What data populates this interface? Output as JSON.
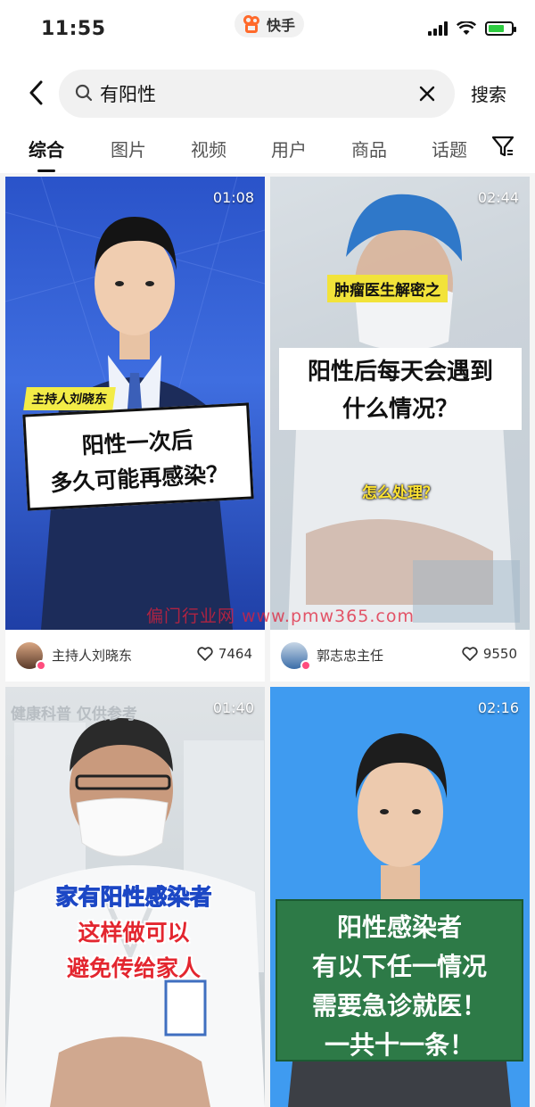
{
  "status": {
    "time": "11:55",
    "app_name": "快手"
  },
  "search": {
    "query": "有阳性",
    "button": "搜索"
  },
  "tabs": [
    "综合",
    "图片",
    "视频",
    "用户",
    "商品",
    "话题"
  ],
  "active_tab": "综合",
  "watermark": "偏门行业网 www.pmw365.com",
  "cards": [
    {
      "duration": "01:08",
      "tag": "主持人刘晓东",
      "caption_line1": "阳性一次后",
      "caption_line2": "多久可能再感染？",
      "author": "主持人刘晓东",
      "likes": "7464"
    },
    {
      "duration": "02:44",
      "tag": "肿瘤医生解密之",
      "caption_line1": "阳性后每天会遇到",
      "caption_line2": "什么情况？",
      "sub": "怎么处理？",
      "author": "郭志忠主任",
      "likes": "9550"
    },
    {
      "duration": "01:40",
      "top_text": "健康科普 仅供参考",
      "caption_line1": "家有阳性感染者",
      "caption_line2": "这样做可以",
      "caption_line3": "避免传给家人"
    },
    {
      "duration": "02:16",
      "caption_line1": "阳性感染者",
      "caption_line2": "有以下任一情况",
      "caption_line3": "需要急诊就医！",
      "caption_line4": "一共十一条！"
    }
  ],
  "colors": {
    "accent": "#ff6a2b",
    "verified": "#ff4d7e",
    "caption_yellow": "#ffe433"
  }
}
